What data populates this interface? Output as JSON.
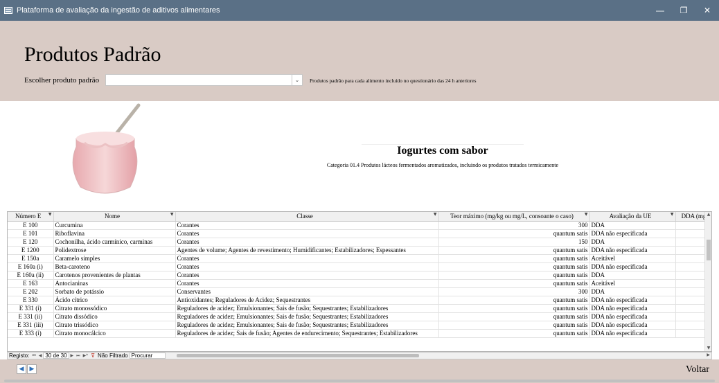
{
  "window": {
    "title": "Plataforma de avaliação da ingestão de aditivos alimentares",
    "minimize": "—",
    "restore": "❐",
    "close": "✕"
  },
  "header": {
    "title": "Produtos Padrão",
    "choose_label": "Escolher produto padrão",
    "combo_value": "",
    "combo_arrow": "⌄",
    "hint": "Produtos padrão para cada alimento incluído no questionário das 24 h anteriores"
  },
  "product": {
    "name": "Iogurtes com sabor",
    "category": "Categoria 01.4 Produtos lácteos fermentados aromatizados, incluindo os produtos tratados termicamente",
    "image_icon": "yogurt-jar-image"
  },
  "grid": {
    "columns": [
      "Número E",
      "Nome",
      "Classe",
      "Teor máximo (mg/kg ou mg/L, consoante o caso)",
      "Avaliação da UE",
      "DDA (mg/k"
    ],
    "rows": [
      [
        "E 100",
        "Curcumina",
        "Corantes",
        "300",
        "DDA",
        ""
      ],
      [
        "E 101",
        "Riboflavina",
        "Corantes",
        "quantum satis",
        "DDA não especificada",
        ""
      ],
      [
        "E 120",
        "Cochonilha, ácido carmínico, carminas",
        "Corantes",
        "150",
        "DDA",
        ""
      ],
      [
        "E 1200",
        "Polidextrose",
        "Agentes de volume; Agentes de revestimento; Humidificantes; Estabilizadores; Espessantes",
        "quantum satis",
        "DDA não especificada",
        ""
      ],
      [
        "E 150a",
        "Caramelo simples",
        "Corantes",
        "quantum satis",
        "Aceitável",
        ""
      ],
      [
        "E 160a (i)",
        "Beta-caroteno",
        "Corantes",
        "quantum satis",
        "DDA não especificada",
        ""
      ],
      [
        "E 160a (ii)",
        "Carotenos provenientes de plantas",
        "Corantes",
        "quantum satis",
        "DDA",
        ""
      ],
      [
        "E 163",
        "Antocianinas",
        "Corantes",
        "quantum satis",
        "Aceitável",
        ""
      ],
      [
        "E 202",
        "Sorbato de potássio",
        "Conservantes",
        "300",
        "DDA",
        ""
      ],
      [
        "E 330",
        "Ácido cítrico",
        "Antioxidantes; Reguladores de Acidez; Sequestrantes",
        "quantum satis",
        "DDA não especificada",
        ""
      ],
      [
        "E 331 (i)",
        "Citrato monossódico",
        "Reguladores de acidez; Emulsionantes; Sais de fusão; Sequestrantes; Estabilizadores",
        "quantum satis",
        "DDA não especificada",
        ""
      ],
      [
        "E 331 (ii)",
        "Citrato dissódico",
        "Reguladores de acidez; Emulsionantes; Sais de fusão; Sequestrantes; Estabilizadores",
        "quantum satis",
        "DDA não especificada",
        ""
      ],
      [
        "E 331 (iii)",
        "Citrato trissódico",
        "Reguladores de acidez; Emulsionantes; Sais de fusão; Sequestrantes; Estabilizadores",
        "quantum satis",
        "DDA não especificada",
        ""
      ],
      [
        "E 333 (i)",
        "Citrato monocálcico",
        "Reguladores de acidez; Sais de fusão; Agentes de endurecimento; Sequestrantes; Estabilizadores",
        "quantum satis",
        "DDA não especificada",
        ""
      ]
    ]
  },
  "navbar": {
    "registo_label": "Registo:",
    "first": "⏮",
    "prev": "◀",
    "position": "30 de 30",
    "next": "▶",
    "last": "⏭",
    "new": "▶*",
    "filter_label": "Não Filtrado",
    "search_label": "Procurar"
  },
  "footer": {
    "prev": "◀",
    "next": "▶",
    "back_label": "Voltar"
  }
}
